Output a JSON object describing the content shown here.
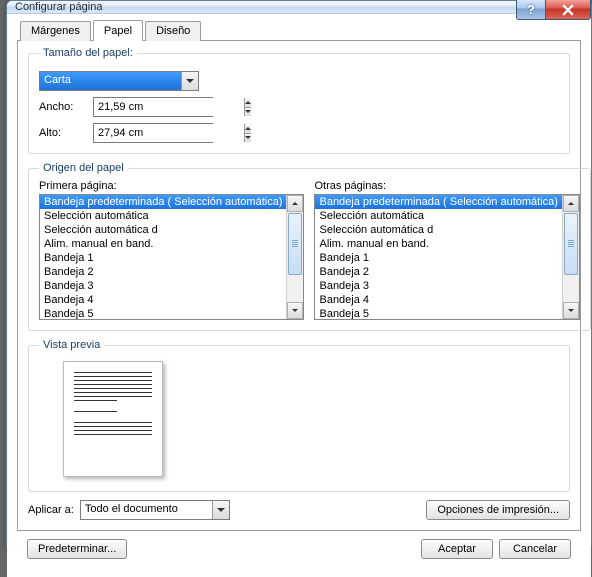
{
  "window": {
    "title": "Configurar página"
  },
  "tabs": {
    "margins": "Márgenes",
    "paper": "Papel",
    "layout": "Diseño"
  },
  "paperSize": {
    "legend": "Tamaño del papel:",
    "selected": "Carta",
    "widthLabel": "Ancho:",
    "widthValue": "21,59 cm",
    "heightLabel": "Alto:",
    "heightValue": "27,94 cm"
  },
  "origin": {
    "legend": "Origen del papel",
    "firstPageLabel": "Primera página:",
    "otherPagesLabel": "Otras páginas:",
    "firstPage": [
      "Bandeja predeterminada ( Selección automática)",
      " Selección automática",
      " Selección automática d",
      " Alim. manual en band.",
      " Bandeja 1",
      " Bandeja 2",
      " Bandeja 3",
      " Bandeja 4",
      " Bandeja 5"
    ],
    "otherPages": [
      "Bandeja predeterminada ( Selección automática)",
      " Selección automática",
      " Selección automática d",
      " Alim. manual en band.",
      " Bandeja 1",
      " Bandeja 2",
      " Bandeja 3",
      " Bandeja 4",
      " Bandeja 5"
    ]
  },
  "preview": {
    "legend": "Vista previa"
  },
  "apply": {
    "label": "Aplicar a:",
    "value": "Todo el documento"
  },
  "buttons": {
    "printOptions": "Opciones de impresión...",
    "default": "Predeterminar...",
    "ok": "Aceptar",
    "cancel": "Cancelar"
  }
}
